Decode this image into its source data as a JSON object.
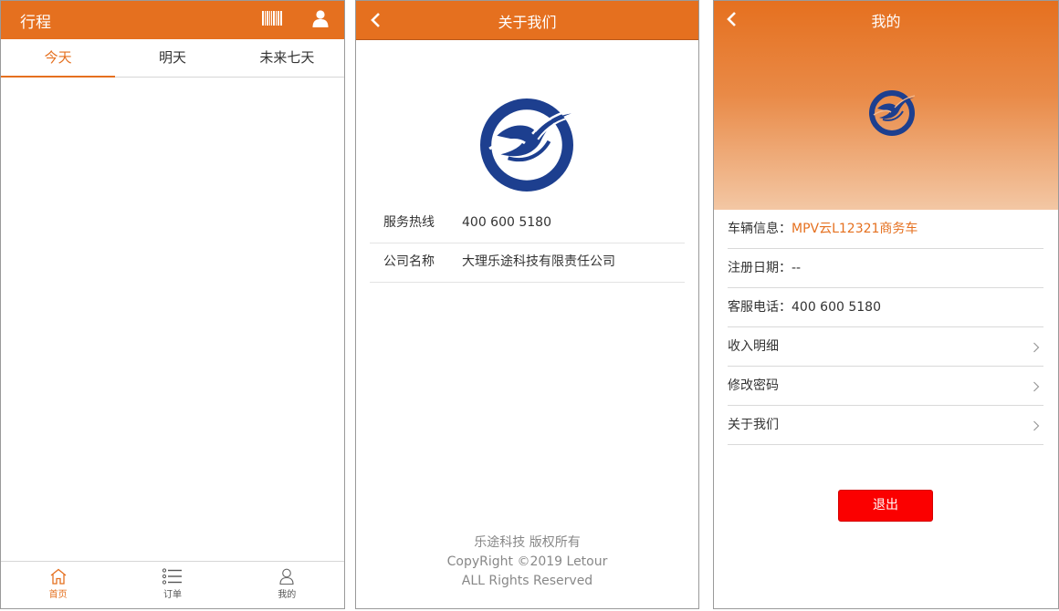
{
  "trip_screen": {
    "title": "行程",
    "header_icons": [
      "barcode-icon",
      "user-icon"
    ],
    "tabs": [
      {
        "label": "今天",
        "active": true
      },
      {
        "label": "明天",
        "active": false
      },
      {
        "label": "未来七天",
        "active": false
      }
    ],
    "bottom_nav": [
      {
        "label": "首页",
        "icon": "home-icon",
        "active": true
      },
      {
        "label": "订单",
        "icon": "list-icon",
        "active": false
      },
      {
        "label": "我的",
        "icon": "person-icon",
        "active": false
      }
    ]
  },
  "about_screen": {
    "title": "关于我们",
    "rows": [
      {
        "label": "服务热线",
        "value": "400 600 5180"
      },
      {
        "label": "公司名称",
        "value": "大理乐途科技有限责任公司"
      }
    ],
    "copyright": {
      "line1": "乐途科技 版权所有",
      "line2": "CopyRight ©2019 Letour",
      "line3": "ALL Rights Reserved"
    }
  },
  "profile_screen": {
    "title": "我的",
    "vehicle": {
      "label": "车辆信息：",
      "value": "MPV云L12321商务车"
    },
    "register_date": {
      "label": "注册日期：",
      "value": "--"
    },
    "service_phone": {
      "label": "客服电话：",
      "value": "400 600 5180"
    },
    "links": [
      "收入明细",
      "修改密码",
      "关于我们"
    ],
    "logout_label": "退出"
  },
  "colors": {
    "accent": "#e5701f",
    "logo_blue": "#1d3f8f",
    "logout_red": "#fb0000"
  }
}
